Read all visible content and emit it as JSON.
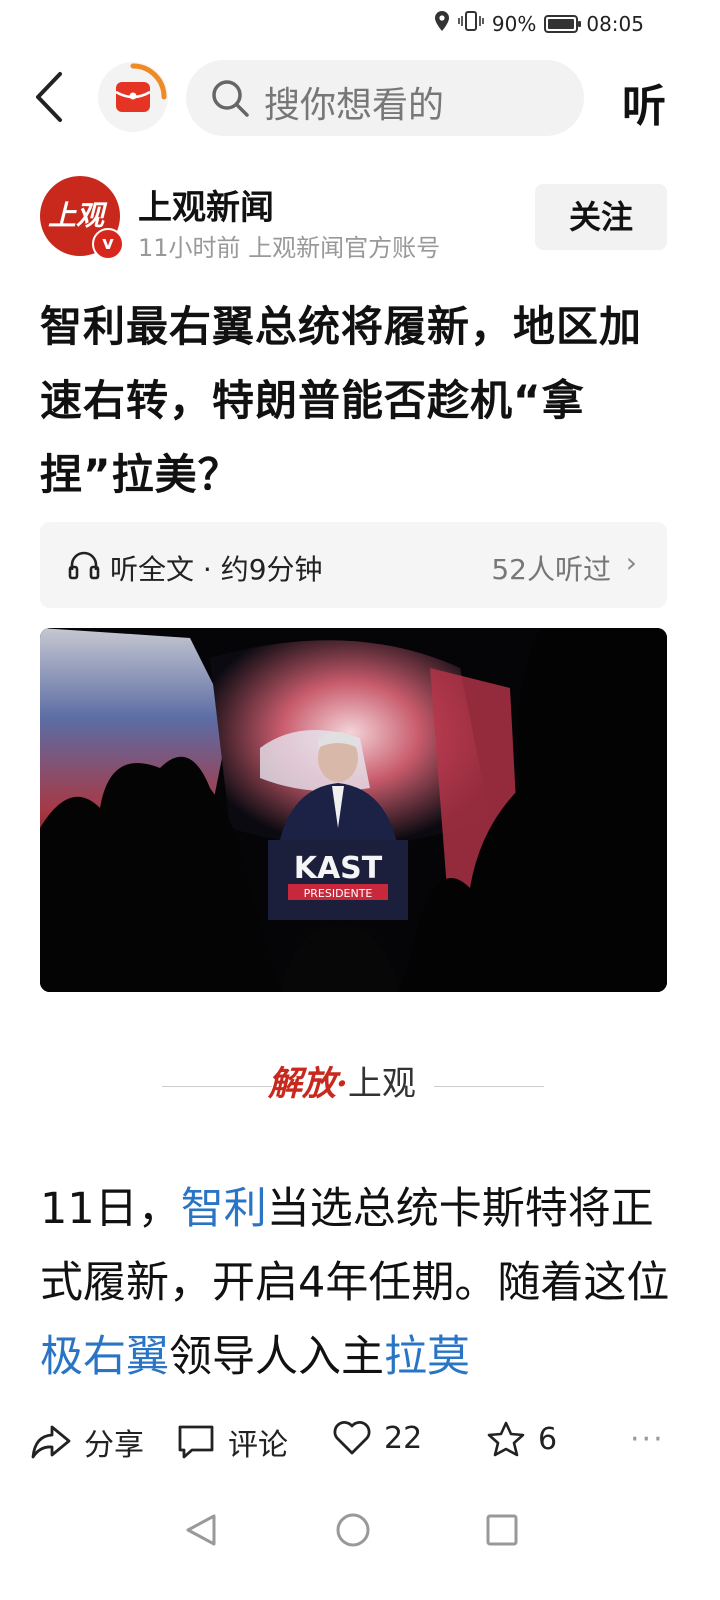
{
  "status_bar": {
    "battery": "90%",
    "time": "08:05"
  },
  "top_nav": {
    "search_placeholder": "搜你想看的",
    "listen_label": "听"
  },
  "author": {
    "avatar_text": "上观",
    "name": "上观新闻",
    "meta": "11小时前  上观新闻官方账号",
    "follow_label": "关注"
  },
  "article": {
    "title": "智利最右翼总统将履新，地区加速右转，特朗普能否趁机“拿捏”拉美？",
    "audio": {
      "label": "听全文 · 约9分钟",
      "listeners": "52人听过",
      "chevron": "›"
    },
    "photo_podium_text": "KAST",
    "photo_podium_sub": "PRESIDENTE",
    "source_logo": {
      "red": "解放",
      "dot": "·",
      "black": "上观"
    },
    "body": {
      "p1": "11日，",
      "link1": "智利",
      "p2": "当选总统卡斯特将正式履新，开启4年任期。随着这位",
      "link2": "极右翼",
      "p3": "领导人入主",
      "link3": "拉莫"
    }
  },
  "actions": {
    "share": "分享",
    "comment": "评论",
    "likes": "22",
    "favorites": "6",
    "more": "···"
  }
}
